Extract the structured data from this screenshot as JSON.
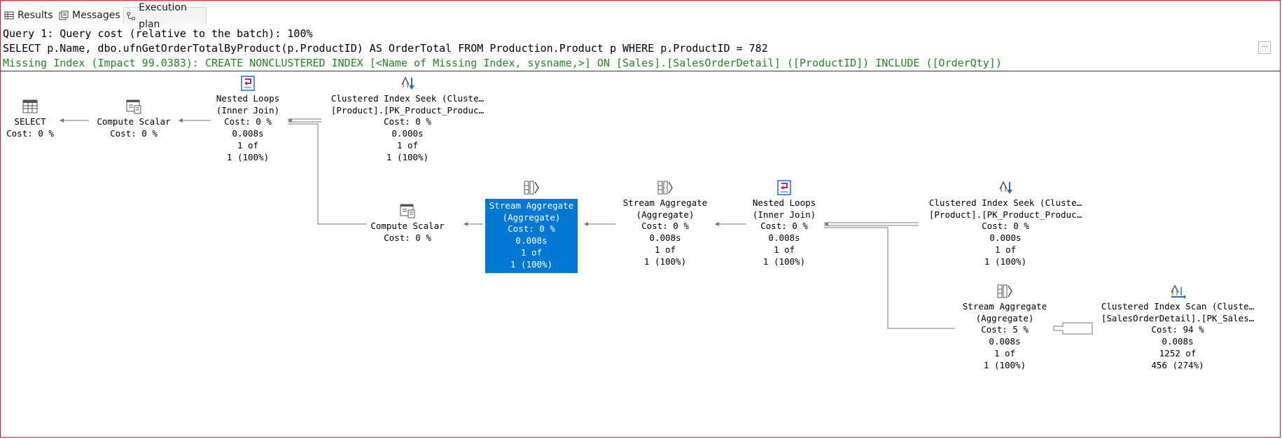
{
  "tabs": [
    {
      "label": "Results",
      "icon": "grid-icon"
    },
    {
      "label": "Messages",
      "icon": "messages-icon"
    },
    {
      "label": "Execution plan",
      "icon": "execution-plan-icon"
    }
  ],
  "header": {
    "query_cost": "Query 1: Query cost (relative to the batch): 100%",
    "sql": "SELECT p.Name, dbo.ufnGetOrderTotalByProduct(p.ProductID) AS OrderTotal FROM Production.Product p WHERE p.ProductID = 782",
    "missing_index": "Missing Index (Impact 99.0383): CREATE NONCLUSTERED INDEX [<Name of Missing Index, sysname,>] ON [Sales].[SalesOrderDetail] ([ProductID]) INCLUDE ([OrderQty])",
    "more_button": "..."
  },
  "colors": {
    "missing_index_text": "#1f8a1f",
    "selected_node_bg": "#0078d4",
    "border": "#e81123"
  },
  "nodes": {
    "select": {
      "icon": "select-icon",
      "lines": [
        "SELECT",
        "Cost: 0 %"
      ]
    },
    "compute1": {
      "icon": "compute-scalar-icon",
      "lines": [
        "Compute Scalar",
        "Cost: 0 %"
      ]
    },
    "nl1": {
      "icon": "nested-loops-icon",
      "lines": [
        "Nested Loops",
        "(Inner Join)",
        "Cost: 0 %",
        "0.008s",
        "1 of",
        "1 (100%)"
      ]
    },
    "seek1": {
      "icon": "clustered-index-seek-icon",
      "lines": [
        "Clustered Index Seek (Cluste…",
        "[Product].[PK_Product_Produc…",
        "Cost: 0 %",
        "0.000s",
        "1 of",
        "1 (100%)"
      ]
    },
    "compute2": {
      "icon": "compute-scalar-icon",
      "lines": [
        "Compute Scalar",
        "Cost: 0 %"
      ]
    },
    "sa1": {
      "icon": "stream-aggregate-icon",
      "lines": [
        "Stream Aggregate",
        "(Aggregate)",
        "Cost: 0 %",
        "0.008s",
        "1 of",
        "1 (100%)"
      ]
    },
    "sa2": {
      "icon": "stream-aggregate-icon",
      "lines": [
        "Stream Aggregate",
        "(Aggregate)",
        "Cost: 0 %",
        "0.008s",
        "1 of",
        "1 (100%)"
      ]
    },
    "nl2": {
      "icon": "nested-loops-icon",
      "lines": [
        "Nested Loops",
        "(Inner Join)",
        "Cost: 0 %",
        "0.008s",
        "1 of",
        "1 (100%)"
      ]
    },
    "seek2": {
      "icon": "clustered-index-seek-icon",
      "lines": [
        "Clustered Index Seek (Cluste…",
        "[Product].[PK_Product_Produc…",
        "Cost: 0 %",
        "0.000s",
        "1 of",
        "1 (100%)"
      ]
    },
    "sa3": {
      "icon": "stream-aggregate-icon",
      "lines": [
        "Stream Aggregate",
        "(Aggregate)",
        "Cost: 5 %",
        "0.008s",
        "1 of",
        "1 (100%)"
      ]
    },
    "scan": {
      "icon": "clustered-index-scan-icon",
      "lines": [
        "Clustered Index Scan (Cluste…",
        "[SalesOrderDetail].[PK_Sales…",
        "Cost: 94 %",
        "0.008s",
        "1252 of",
        "456 (274%)"
      ]
    }
  }
}
